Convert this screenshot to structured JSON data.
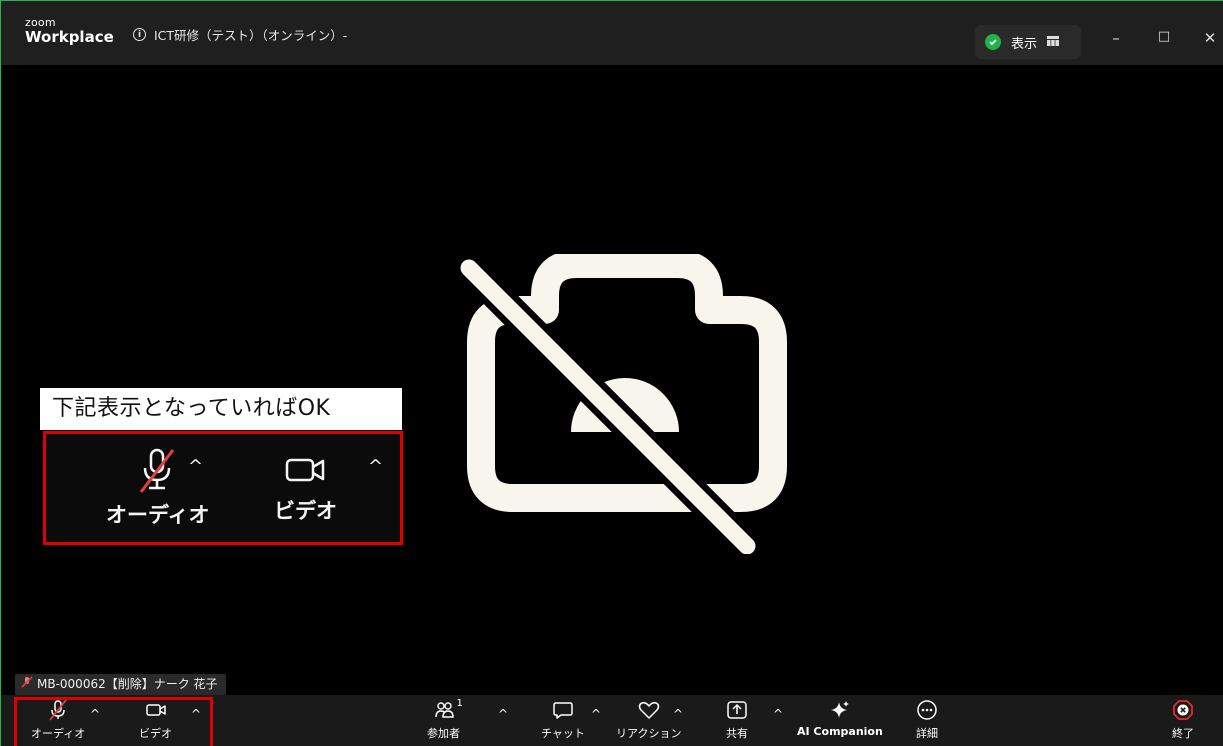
{
  "app": {
    "brand_top": "zoom",
    "brand_bottom": "Workplace",
    "meeting_title": "ICT研修（テスト）（オンライン）-",
    "view_label": "表示"
  },
  "window_controls": {
    "minimize": "–",
    "maximize": "□",
    "close": "✕"
  },
  "annotation": {
    "callout_text": "下記表示となっていればOK",
    "audio_label": "オーディオ",
    "video_label": "ビデオ"
  },
  "participant": {
    "name_tag": "MB-000062【削除】ナーク 花子"
  },
  "toolbar": {
    "audio": "オーディオ",
    "video": "ビデオ",
    "participants": "参加者",
    "participants_count": "1",
    "chat": "チャット",
    "reactions": "リアクション",
    "share": "共有",
    "ai_companion": "AI Companion",
    "more": "詳細",
    "end": "終了"
  },
  "colors": {
    "accent_red": "#e00000",
    "shield_green": "#21b14b",
    "end_red": "#e02d2d"
  }
}
